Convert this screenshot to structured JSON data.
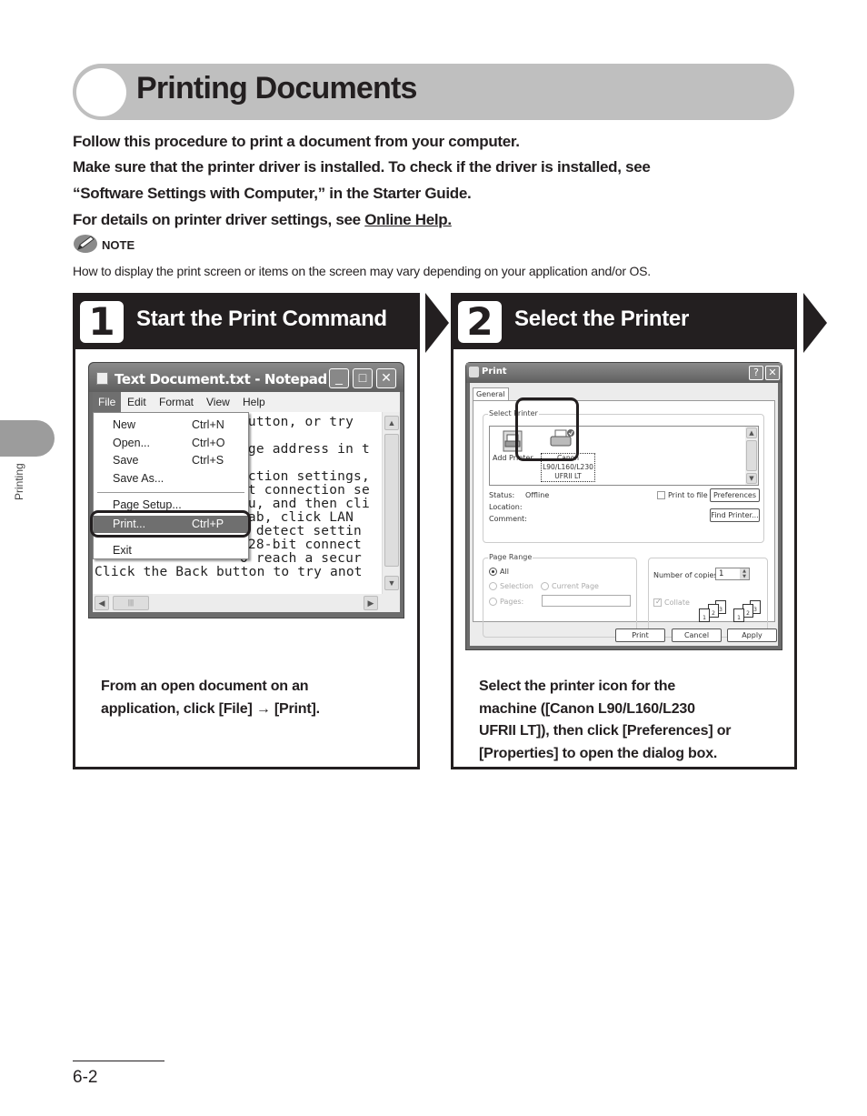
{
  "title": "Printing Documents",
  "intro": {
    "line1": "Follow this procedure to print a document from your computer.",
    "line2": "Make sure that the printer driver is installed. To check if the driver is installed, see",
    "line3": "“Software Settings with Computer,” in the Starter Guide.",
    "line4_prefix": "For details on printer driver settings, see ",
    "line4_link": "Online Help."
  },
  "note": {
    "label": "NOTE",
    "icon": "pencil-icon",
    "text": "How to display the print screen or items on the screen may vary depending on your application and/or OS."
  },
  "steps": [
    {
      "number": "1",
      "title": "Start the Print Command",
      "description_line1": "From an open document on an",
      "description_line2": "application, click [File] → [Print]."
    },
    {
      "number": "2",
      "title": "Select the Printer",
      "description_line1": "Select the printer icon for the",
      "description_line2": "machine ([Canon L90/L160/L230",
      "description_line3": "UFRII LT]), then click [Preferences] or",
      "description_line4": "[Properties] to open the dialog box."
    }
  ],
  "notepad": {
    "window_title": "Text Document.txt - Notepad",
    "minimize": "_",
    "maximize": "□",
    "close": "✕",
    "menus": [
      "File",
      "Edit",
      "Format",
      "View",
      "Help"
    ],
    "file_menu": [
      {
        "label": "New",
        "shortcut": "Ctrl+N"
      },
      {
        "label": "Open...",
        "shortcut": "Ctrl+O"
      },
      {
        "label": "Save",
        "shortcut": "Ctrl+S"
      },
      {
        "label": "Save As...",
        "shortcut": ""
      },
      {
        "label": "Page Setup...",
        "shortcut": ""
      },
      {
        "label": "Print...",
        "shortcut": "Ctrl+P"
      },
      {
        "label": "Exit",
        "shortcut": ""
      }
    ],
    "text_lines": [
      "  button, or try",
      "",
      "  age address in t",
      "",
      "  ection settings,",
      "  et connection se",
      "  nu, and then cli",
      "  tab, click LAN",
      "  y detect settin",
      "  128-bit connect",
      "  o reach a secur",
      "Click the  Back button to try anot"
    ]
  },
  "print_dialog": {
    "title": "Print",
    "help_btn": "?",
    "close_btn": "✕",
    "tab": "General",
    "select_printer_legend": "Select Printer",
    "add_printer": "Add Printer",
    "printer_name_line1": "Canon",
    "printer_name_line2": "L90/L160/L230",
    "printer_name_line3": "UFRII LT",
    "status_label": "Status:",
    "status_value": "Offline",
    "location_label": "Location:",
    "comment_label": "Comment:",
    "print_to_file": "Print to file",
    "preferences": "Preferences",
    "find_printer": "Find Printer...",
    "page_range_legend": "Page Range",
    "all": "All",
    "selection": "Selection",
    "current_page": "Current Page",
    "pages": "Pages:",
    "copies_label": "Number of copies:",
    "copies_value": "1",
    "collate": "Collate",
    "print_btn": "Print",
    "cancel_btn": "Cancel",
    "apply_btn": "Apply"
  },
  "side_tab": "Printing",
  "page_number": "6-2"
}
